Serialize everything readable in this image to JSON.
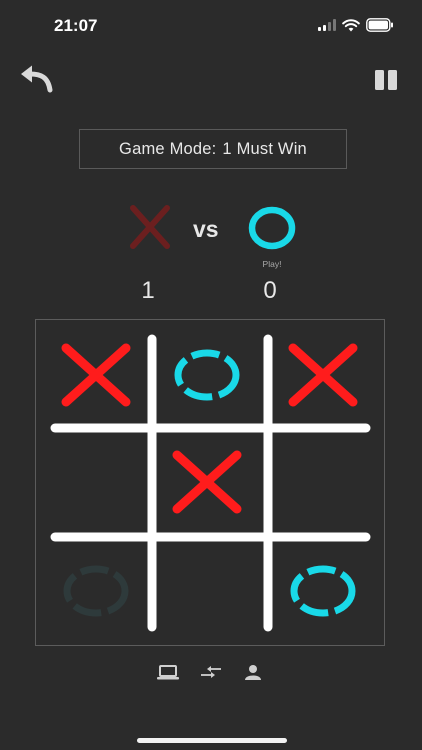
{
  "status_bar": {
    "time": "21:07"
  },
  "toolbar": {
    "undo_icon": "undo-arrow-icon",
    "pause_icon": "pause-icon"
  },
  "game_mode": {
    "label": "Game Mode:",
    "value": "1 Must Win"
  },
  "players": {
    "x": {
      "symbol": "X",
      "score": "1",
      "color": "#6b1f1f"
    },
    "vs": "vs",
    "o": {
      "symbol": "O",
      "score": "0",
      "color": "#19d9e8",
      "turn_label": "Play!"
    }
  },
  "board": {
    "cells": [
      "X",
      "O",
      "X",
      "",
      "X",
      "",
      "O-faded",
      "",
      "O"
    ],
    "x_color": "#ff1c1c",
    "o_color": "#19d9e8",
    "o_faded_color": "#2e3a3b",
    "grid_color": "#ffffff"
  },
  "bottom_bar": [
    "computer-icon",
    "swap-icon",
    "person-icon"
  ]
}
